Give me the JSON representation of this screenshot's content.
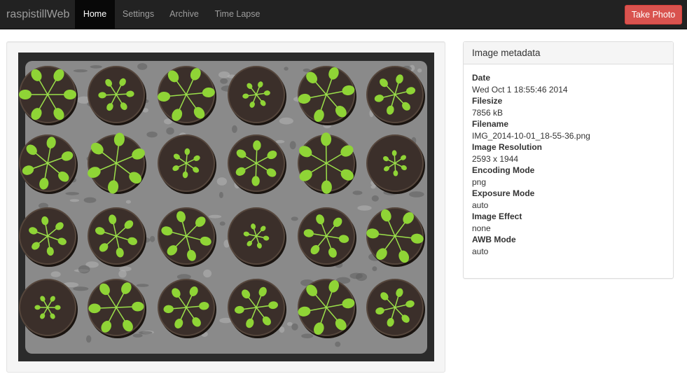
{
  "navbar": {
    "brand": "raspistillWeb",
    "items": [
      {
        "label": "Home",
        "active": true
      },
      {
        "label": "Settings",
        "active": false
      },
      {
        "label": "Archive",
        "active": false
      },
      {
        "label": "Time Lapse",
        "active": false
      }
    ],
    "take_photo_label": "Take Photo"
  },
  "metadata_panel": {
    "title": "Image metadata",
    "fields": [
      {
        "label": "Date",
        "value": "Wed Oct 1 18:55:46 2014"
      },
      {
        "label": "Filesize",
        "value": "7856 kB"
      },
      {
        "label": "Filename",
        "value": "IMG_2014-10-01_18-55-36.png"
      },
      {
        "label": "Image Resolution",
        "value": "2593 x 1944"
      },
      {
        "label": "Encoding Mode",
        "value": "png"
      },
      {
        "label": "Exposure Mode",
        "value": "auto"
      },
      {
        "label": "Image Effect",
        "value": "none"
      },
      {
        "label": "AWB Mode",
        "value": "auto"
      }
    ]
  },
  "colors": {
    "navbar_bg": "#222222",
    "nav_active_bg": "#080808",
    "take_photo_bg": "#d9534f",
    "tray": "#2b2b2b",
    "foil": "#8a8a8a",
    "soil": "#3b2f2a",
    "leaf": "#8fd436"
  }
}
